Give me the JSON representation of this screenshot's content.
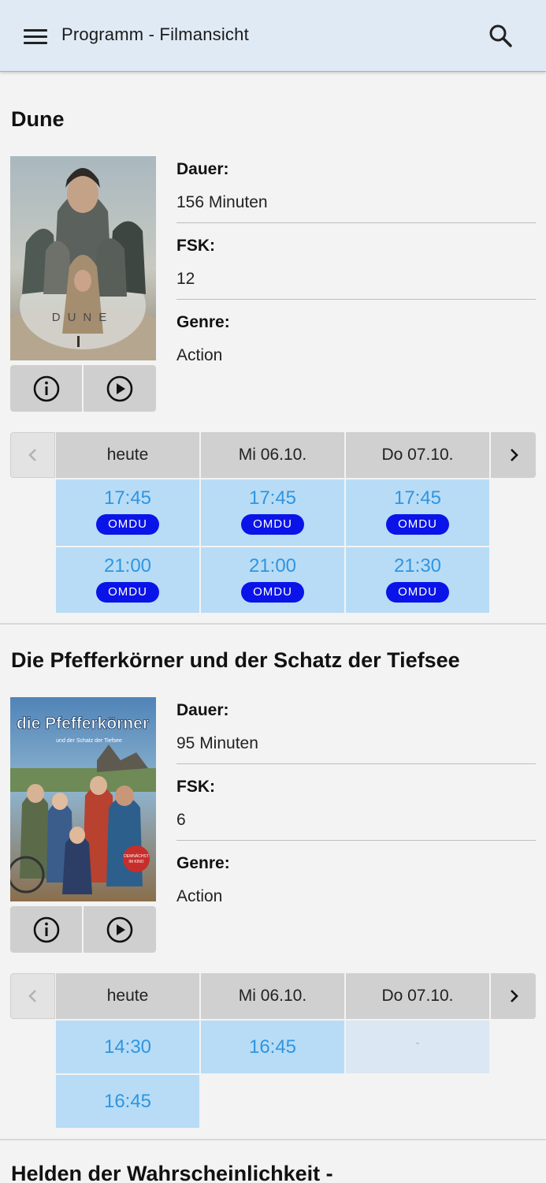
{
  "appbar": {
    "title": "Programm - Filmansicht",
    "menu_icon": "hamburger-menu-icon",
    "search_icon": "search-icon"
  },
  "labels": {
    "duration": "Dauer:",
    "fsk": "FSK:",
    "genre": "Genre:"
  },
  "films": [
    {
      "title": "Dune",
      "poster_text": "DUNE",
      "duration": "156 Minuten",
      "fsk": "12",
      "genre": "Action",
      "days": [
        "heute",
        "Mi 06.10.",
        "Do 07.10."
      ],
      "rows": [
        [
          {
            "time": "17:45",
            "tag": "OMDU"
          },
          {
            "time": "17:45",
            "tag": "OMDU"
          },
          {
            "time": "17:45",
            "tag": "OMDU"
          }
        ],
        [
          {
            "time": "21:00",
            "tag": "OMDU"
          },
          {
            "time": "21:00",
            "tag": "OMDU"
          },
          {
            "time": "21:30",
            "tag": "OMDU"
          }
        ]
      ]
    },
    {
      "title": "Die Pfefferkörner und der Schatz der Tiefsee",
      "poster_text": "die Pfefferkörner",
      "poster_subtext": "und der Schatz der Tiefsee",
      "poster_badge": "DEMNÄCHST IM KINO",
      "duration": "95 Minuten",
      "fsk": "6",
      "genre": "Action",
      "days": [
        "heute",
        "Mi 06.10.",
        "Do 07.10."
      ],
      "rows": [
        [
          {
            "time": "14:30"
          },
          {
            "time": "16:45"
          },
          {
            "time": "-"
          }
        ],
        [
          {
            "time": "16:45"
          }
        ]
      ]
    },
    {
      "title": "Helden der Wahrscheinlichkeit -"
    }
  ],
  "colors": {
    "appbar_bg": "#e0eaf5",
    "slot_bg": "#b8dcf6",
    "slot_empty_bg": "#dbe8f3",
    "time_text": "#2f95e0",
    "badge_bg": "#0a14e8",
    "day_header_bg": "#d0d0d0"
  }
}
